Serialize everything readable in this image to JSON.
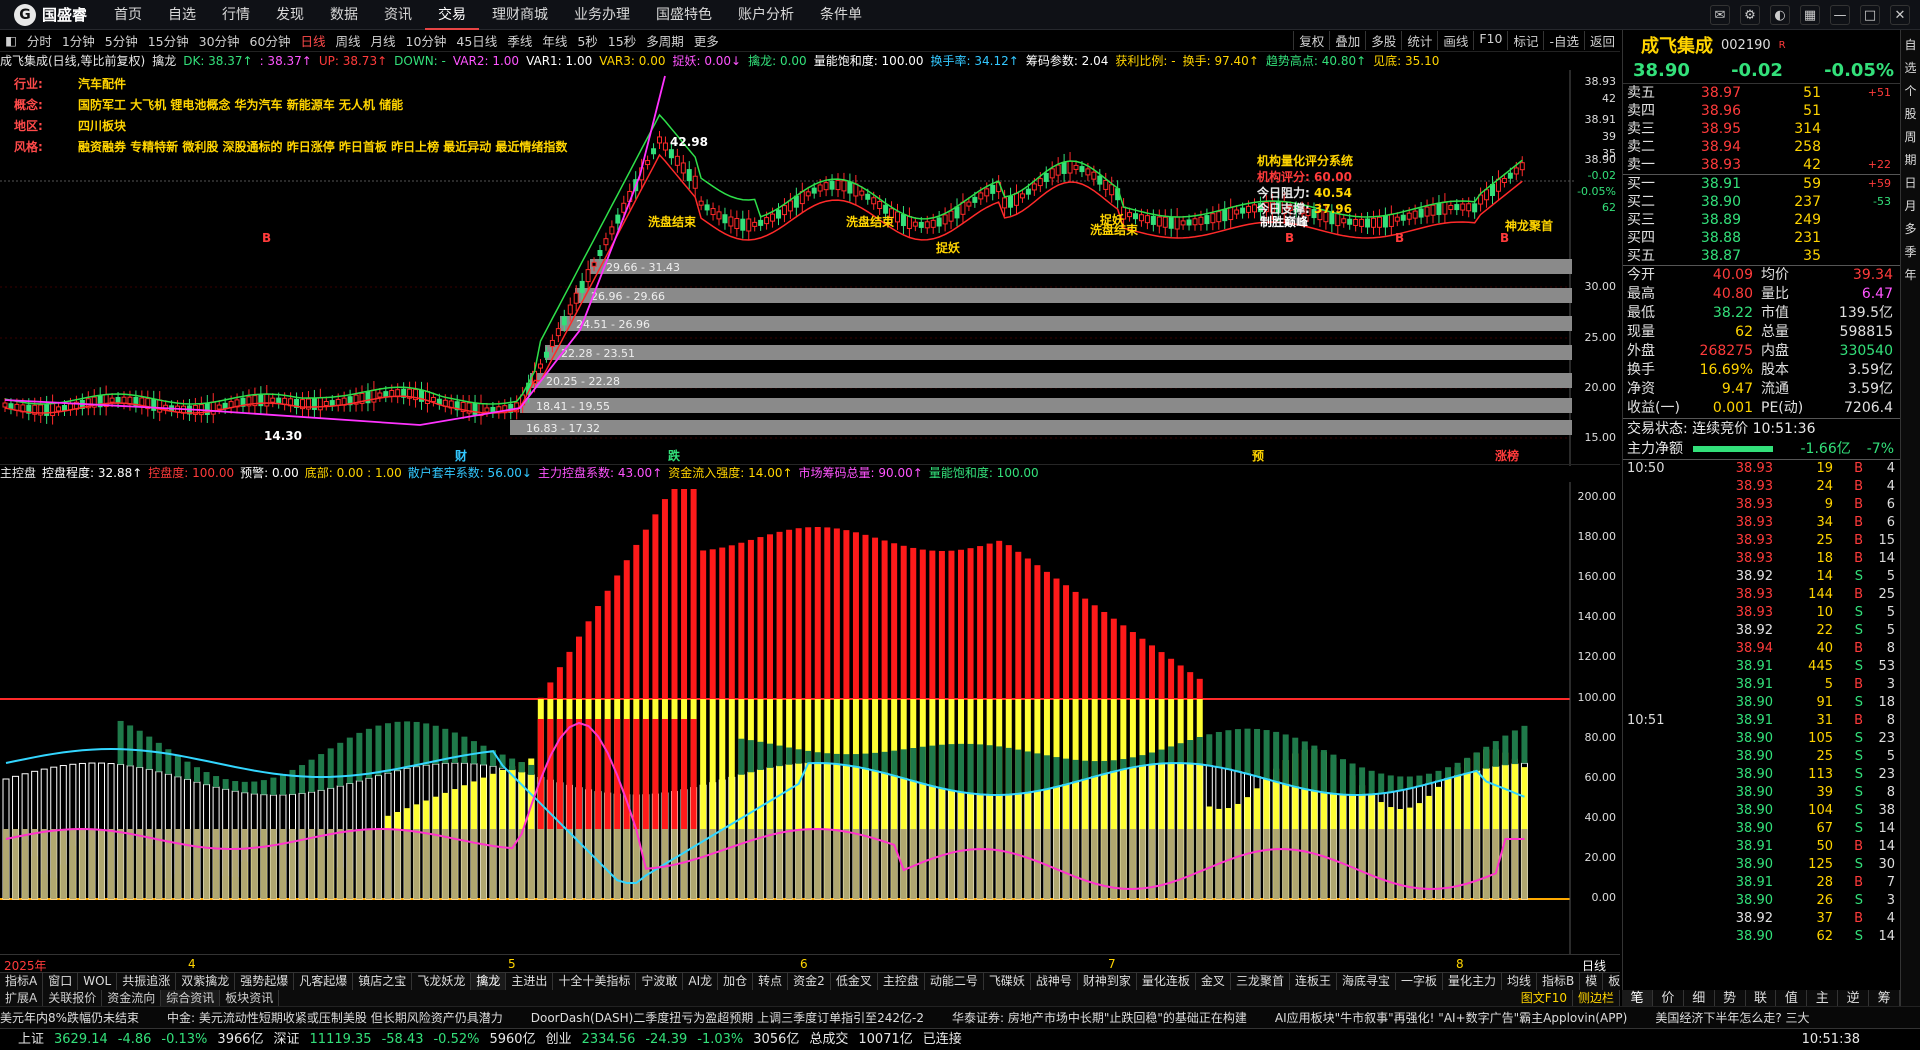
{
  "nav": {
    "logo": "国盛睿",
    "items": [
      "首页",
      "自选",
      "行情",
      "发现",
      "数据",
      "资讯",
      "交易",
      "理财商城",
      "业务办理",
      "国盛特色",
      "账户分析",
      "条件单"
    ]
  },
  "period": {
    "items": [
      "分时",
      "1分钟",
      "5分钟",
      "15分钟",
      "30分钟",
      "60分钟",
      "日线",
      "周线",
      "月线",
      "10分钟",
      "45日线",
      "季线",
      "年线",
      "5秒",
      "15秒",
      "多周期",
      "更多"
    ],
    "right": [
      "复权",
      "叠加",
      "多股",
      "统计",
      "画线",
      "F10",
      "标记",
      "-自选",
      "返回"
    ]
  },
  "ind1": [
    {
      "t": "成飞集成(日线,等比前复权)",
      "c": "#e8e8e8"
    },
    {
      "t": "擒龙",
      "c": "#e8e8e8"
    },
    {
      "t": "DK: 38.37↑",
      "c": "#33e07a"
    },
    {
      "t": ": 38.37↑",
      "c": "#ff55ff"
    },
    {
      "t": "UP: 38.73↑",
      "c": "#ff3b3b"
    },
    {
      "t": "DOWN: -",
      "c": "#33e07a"
    },
    {
      "t": "VAR2: 1.00",
      "c": "#ff55ff"
    },
    {
      "t": "VAR1: 1.00",
      "c": "#ffffff"
    },
    {
      "t": "VAR3: 0.00",
      "c": "#ffd400"
    },
    {
      "t": "捉妖: 0.00↓",
      "c": "#ff55ff"
    },
    {
      "t": "擒龙: 0.00",
      "c": "#33e07a"
    },
    {
      "t": "量能饱和度: 100.00",
      "c": "#ffffff"
    },
    {
      "t": "换手率: 34.12↑",
      "c": "#33c8ff"
    },
    {
      "t": "筹码参数: 2.04",
      "c": "#ffffff"
    },
    {
      "t": "获利比例: -",
      "c": "#ffd400"
    },
    {
      "t": "换手: 97.40↑",
      "c": "#ffd400"
    },
    {
      "t": "趋势高点: 40.80↑",
      "c": "#33e07a"
    },
    {
      "t": "见底: 35.10",
      "c": "#ffd400"
    }
  ],
  "info": [
    {
      "k": "行业:",
      "v": "汽车配件"
    },
    {
      "k": "概念:",
      "v": "国防军工 大飞机 锂电池概念 华为汽车 新能源车 无人机 储能"
    },
    {
      "k": "地区:",
      "v": "四川板块"
    },
    {
      "k": "风格:",
      "v": "融资融券 专精特新 微利股 深股通标的 昨日涨停 昨日首板 昨日上榜 最近异动 最近情绪指数"
    }
  ],
  "yaxis": [
    "38.93",
    "42",
    "38.91",
    "39",
    "35",
    "38.90",
    "-0.02",
    "-0.05%",
    "62",
    "30.00",
    "25.00",
    "20.00",
    "15.00"
  ],
  "ranges": [
    "29.66 - 31.43",
    "26.96 - 29.66",
    "24.51 - 26.96",
    "22.28 - 23.51",
    "20.25 - 22.28",
    "18.41 - 19.55",
    "16.83 - 17.32"
  ],
  "annot": {
    "peak": "42.98",
    "low": "14.30",
    "xipan1": "洗盘结束",
    "xipan2": "洗盘结束",
    "xipan3": "洗盘结束",
    "zhuoyao1": "捉妖",
    "zhuoyao2": "捉妖",
    "zhuoyao3": "捉妖",
    "jichu": "制胜巅峰",
    "zhuo": "捉妖",
    "shenlong": "神龙聚首",
    "fin": "财",
    "die": "跌",
    "yu": "预",
    "zhangting": "涨榜",
    "b": "B"
  },
  "quant": {
    "title": "机构量化评分系统",
    "score_label": "机构评分:",
    "score": "60.00",
    "zl_label": "今日阻力:",
    "zl": "40.54",
    "zc_label": "今日支撑:",
    "zc": "37.96"
  },
  "ind2": [
    {
      "t": "主控盘",
      "c": "#e8e8e8"
    },
    {
      "t": "控盘程度: 32.88↑",
      "c": "#ffffff"
    },
    {
      "t": "控盘度: 100.00",
      "c": "#ff3b3b"
    },
    {
      "t": "预警: 0.00",
      "c": "#ffffff"
    },
    {
      "t": "底部: 0.00 : 1.00",
      "c": "#ffd400"
    },
    {
      "t": "散户套牢系数: 56.00↓",
      "c": "#33c8ff"
    },
    {
      "t": "主力控盘系数: 43.00↑",
      "c": "#ff55ff"
    },
    {
      "t": "资金流入强度: 14.00↑",
      "c": "#ffd400"
    },
    {
      "t": "市场筹码总量: 90.00↑",
      "c": "#ff55ff"
    },
    {
      "t": "量能饱和度: 100.00",
      "c": "#33e07a"
    }
  ],
  "ind2_yaxis": [
    "200.00",
    "180.00",
    "160.00",
    "140.00",
    "120.00",
    "100.00",
    "80.00",
    "60.00",
    "40.00",
    "20.00",
    "0.00"
  ],
  "xaxis": [
    {
      "t": "2025年",
      "c": "#ff3b3b"
    },
    {
      "t": "4",
      "c": "#ffd400"
    },
    {
      "t": "5",
      "c": "#ffd400"
    },
    {
      "t": "6",
      "c": "#ffd400"
    },
    {
      "t": "7",
      "c": "#ffd400"
    },
    {
      "t": "8",
      "c": "#ffd400"
    }
  ],
  "xaxis_right": "日线",
  "tabs": [
    "指标A",
    "窗口",
    "WOL",
    "共振追涨",
    "双紫擒龙",
    "强势起爆",
    "凡客起爆",
    "镇店之宝",
    "飞龙妖龙",
    "擒龙",
    "主进出",
    "十全十美指标",
    "宁波敢",
    "AI龙",
    "加仓",
    "转点",
    "资金2",
    "低金叉",
    "主控盘",
    "动能二号",
    "飞碟妖",
    "战神号",
    "财神到家",
    "量化连板",
    "金叉",
    "三龙聚首",
    "连板王",
    "海底寻宝",
    "一字板",
    "量化主力",
    "均线"
  ],
  "tabs_right": [
    "指标B",
    "模",
    "板"
  ],
  "tabs2": [
    "扩展A",
    "关联报价",
    "资金流向",
    "综合资讯",
    "板块资讯"
  ],
  "tabs2_right": [
    "图文F10",
    "侧边栏"
  ],
  "ticker": [
    "美元年内8%跌幅仍未结束",
    "中金: 美元流动性短期收紧或压制美股 但长期风险资产仍具潜力",
    "DoorDash(DASH)二季度扭亏为盈超预期 上调三季度订单指引至242亿-2",
    "华泰证券: 房地产市场中长期\"止跌回稳\"的基础正在构建",
    "AI应用板块\"牛市叙事\"再强化! \"AI+数字广告\"霸主Applovin(APP)",
    "美国经济下半年怎么走? 三大"
  ],
  "status": {
    "sh_label": "上证",
    "sh": "3629.14",
    "sh_chg": "-4.86",
    "sh_pct": "-0.13%",
    "sh_amt": "3966亿",
    "sz_label": "深证",
    "sz": "11119.35",
    "sz_chg": "-58.43",
    "sz_pct": "-0.52%",
    "sz_amt": "5960亿",
    "cy_label": "创业",
    "cy": "2334.56",
    "cy_chg": "-24.39",
    "cy_pct": "-1.03%",
    "cy_amt": "3056亿",
    "total_label": "总成交",
    "total": "10071亿",
    "conn": "已连接",
    "time": "10:51:38"
  },
  "rp": {
    "name": "成飞集成",
    "code": "002190",
    "tag": "R",
    "price": "38.90",
    "chg": "-0.02",
    "pct": "-0.05%",
    "asks": [
      {
        "l": "卖五",
        "p": "38.97",
        "v": "51",
        "c": "+51"
      },
      {
        "l": "卖四",
        "p": "38.96",
        "v": "51",
        "c": ""
      },
      {
        "l": "卖三",
        "p": "38.95",
        "v": "314",
        "c": ""
      },
      {
        "l": "卖二",
        "p": "38.94",
        "v": "258",
        "c": ""
      },
      {
        "l": "卖一",
        "p": "38.93",
        "v": "42",
        "c": "+22"
      }
    ],
    "bids": [
      {
        "l": "买一",
        "p": "38.91",
        "v": "59",
        "c": "+59"
      },
      {
        "l": "买二",
        "p": "38.90",
        "v": "237",
        "c": "-53"
      },
      {
        "l": "买三",
        "p": "38.89",
        "v": "249",
        "c": ""
      },
      {
        "l": "买四",
        "p": "38.88",
        "v": "231",
        "c": ""
      },
      {
        "l": "买五",
        "p": "38.87",
        "v": "35",
        "c": ""
      }
    ],
    "quote": [
      {
        "l1": "今开",
        "v1": "40.09",
        "l2": "均价",
        "v2": "39.34"
      },
      {
        "l1": "最高",
        "v1": "40.80",
        "l2": "量比",
        "v2": "6.47"
      },
      {
        "l1": "最低",
        "v1": "38.22",
        "l2": "市值",
        "v2": "139.5亿"
      },
      {
        "l1": "现量",
        "v1": "62",
        "l2": "总量",
        "v2": "598815"
      },
      {
        "l1": "外盘",
        "v1": "268275",
        "l2": "内盘",
        "v2": "330540"
      },
      {
        "l1": "换手",
        "v1": "16.69%",
        "l2": "股本",
        "v2": "3.59亿"
      },
      {
        "l1": "净资",
        "v1": "9.47",
        "l2": "流通",
        "v2": "3.59亿"
      },
      {
        "l1": "收益(一)",
        "v1": "0.001",
        "l2": "PE(动)",
        "v2": "7206.4"
      }
    ],
    "state": "交易状态: 连续竞价 10:51:36",
    "net_label": "主力净额",
    "net": "-1.66亿",
    "net_pct": "-7%",
    "ticks": [
      {
        "t": "10:50",
        "p": "38.93",
        "v": "19",
        "b": "B",
        "n": "4"
      },
      {
        "t": "",
        "p": "38.93",
        "v": "24",
        "b": "B",
        "n": "4"
      },
      {
        "t": "",
        "p": "38.93",
        "v": "9",
        "b": "B",
        "n": "6"
      },
      {
        "t": "",
        "p": "38.93",
        "v": "34",
        "b": "B",
        "n": "6"
      },
      {
        "t": "",
        "p": "38.93",
        "v": "25",
        "b": "B",
        "n": "15"
      },
      {
        "t": "",
        "p": "38.93",
        "v": "18",
        "b": "B",
        "n": "14"
      },
      {
        "t": "",
        "p": "38.92",
        "v": "14",
        "b": "S",
        "n": "5"
      },
      {
        "t": "",
        "p": "38.93",
        "v": "144",
        "b": "B",
        "n": "25"
      },
      {
        "t": "",
        "p": "38.93",
        "v": "10",
        "b": "S",
        "n": "5"
      },
      {
        "t": "",
        "p": "38.92",
        "v": "22",
        "b": "S",
        "n": "5"
      },
      {
        "t": "",
        "p": "38.94",
        "v": "40",
        "b": "B",
        "n": "8"
      },
      {
        "t": "",
        "p": "38.91",
        "v": "445",
        "b": "S",
        "n": "53"
      },
      {
        "t": "",
        "p": "38.91",
        "v": "5",
        "b": "B",
        "n": "3"
      },
      {
        "t": "",
        "p": "38.90",
        "v": "91",
        "b": "S",
        "n": "18"
      },
      {
        "t": "10:51",
        "p": "38.91",
        "v": "31",
        "b": "B",
        "n": "8"
      },
      {
        "t": "",
        "p": "38.90",
        "v": "105",
        "b": "S",
        "n": "23"
      },
      {
        "t": "",
        "p": "38.90",
        "v": "25",
        "b": "S",
        "n": "5"
      },
      {
        "t": "",
        "p": "38.90",
        "v": "113",
        "b": "S",
        "n": "23"
      },
      {
        "t": "",
        "p": "38.90",
        "v": "39",
        "b": "S",
        "n": "8"
      },
      {
        "t": "",
        "p": "38.90",
        "v": "104",
        "b": "S",
        "n": "38"
      },
      {
        "t": "",
        "p": "38.90",
        "v": "67",
        "b": "S",
        "n": "14"
      },
      {
        "t": "",
        "p": "38.91",
        "v": "50",
        "b": "B",
        "n": "14"
      },
      {
        "t": "",
        "p": "38.90",
        "v": "125",
        "b": "S",
        "n": "30"
      },
      {
        "t": "",
        "p": "38.91",
        "v": "28",
        "b": "B",
        "n": "7"
      },
      {
        "t": "",
        "p": "38.90",
        "v": "26",
        "b": "S",
        "n": "3"
      },
      {
        "t": "",
        "p": "38.92",
        "v": "37",
        "b": "B",
        "n": "4"
      },
      {
        "t": "",
        "p": "38.90",
        "v": "62",
        "b": "S",
        "n": "14"
      }
    ],
    "btabs": [
      "笔",
      "价",
      "细",
      "势",
      "联",
      "值",
      "主",
      "逆",
      "筹"
    ]
  },
  "vbar": [
    "自",
    "选",
    "个",
    "股",
    "周",
    "期",
    "日",
    "月",
    "多",
    "季",
    "年"
  ]
}
